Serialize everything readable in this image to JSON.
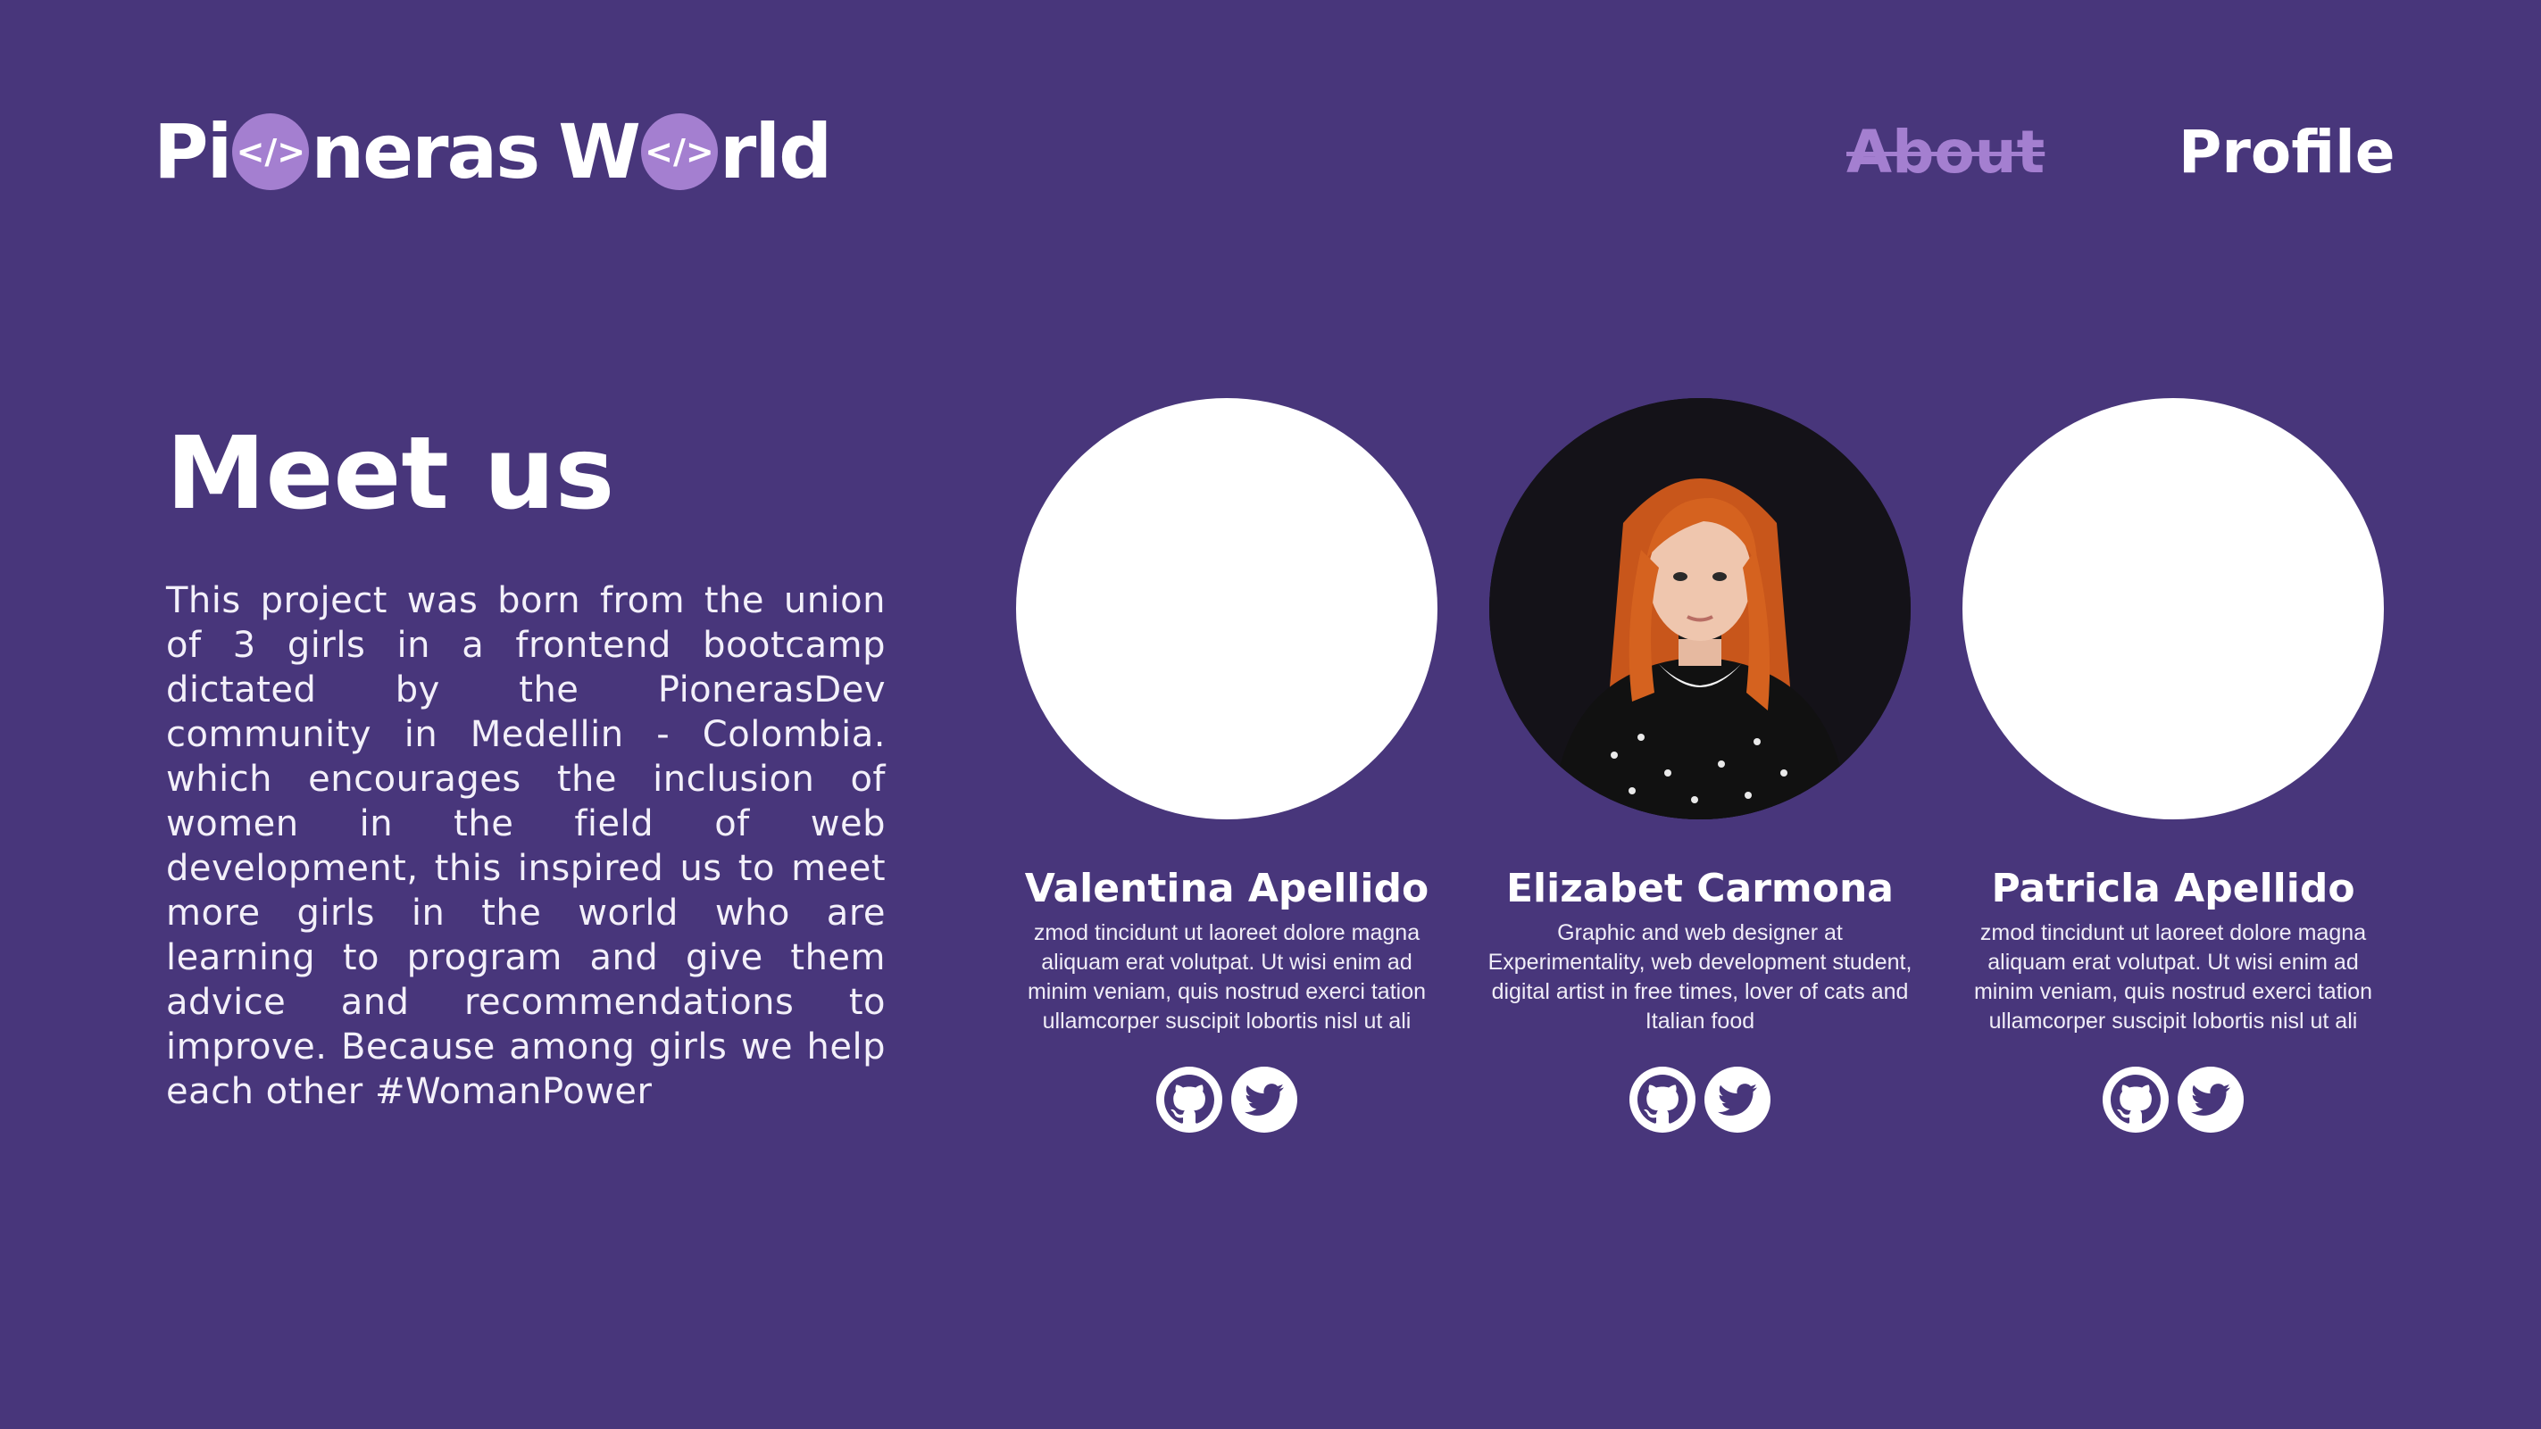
{
  "header": {
    "logo": {
      "part1": "Pi",
      "part2": "neras",
      "part3": "W",
      "part4": "rld",
      "badge": "</>"
    },
    "nav": {
      "about": "About",
      "profile": "Profile"
    }
  },
  "main": {
    "title": "Meet us",
    "intro": "This project was born from the union of 3 girls in a frontend bootcamp dictated by the PionerasDev community in Medellin - Colombia. which encourages the inclusion of women in the field of web development, this inspired us to meet more girls in the world who are learning to program and give them advice and recommendations to improve. Because among girls we help each other #WomanPower"
  },
  "team": [
    {
      "name": "Valentina Apellido",
      "bio": "zmod tincidunt ut laoreet dolore magna aliquam erat volutpat. Ut wisi enim ad minim veniam, quis nostrud exerci tation ullamcorper suscipit lobortis nisl ut ali"
    },
    {
      "name": "Elizabet Carmona",
      "bio": "Graphic and web designer at Experimentality, web development student, digital artist in free times, lover of cats and Italian  food"
    },
    {
      "name": "Patricla Apellido",
      "bio": "zmod tincidunt ut laoreet dolore magna aliquam erat volutpat. Ut wisi enim ad minim veniam, quis nostrud exerci tation ullamcorper suscipit lobortis nisl ut ali"
    }
  ],
  "icons": {
    "github": "github-icon",
    "twitter": "twitter-icon"
  },
  "colors": {
    "background": "#48367b",
    "accent": "#a47fd0",
    "text": "#ffffff"
  }
}
